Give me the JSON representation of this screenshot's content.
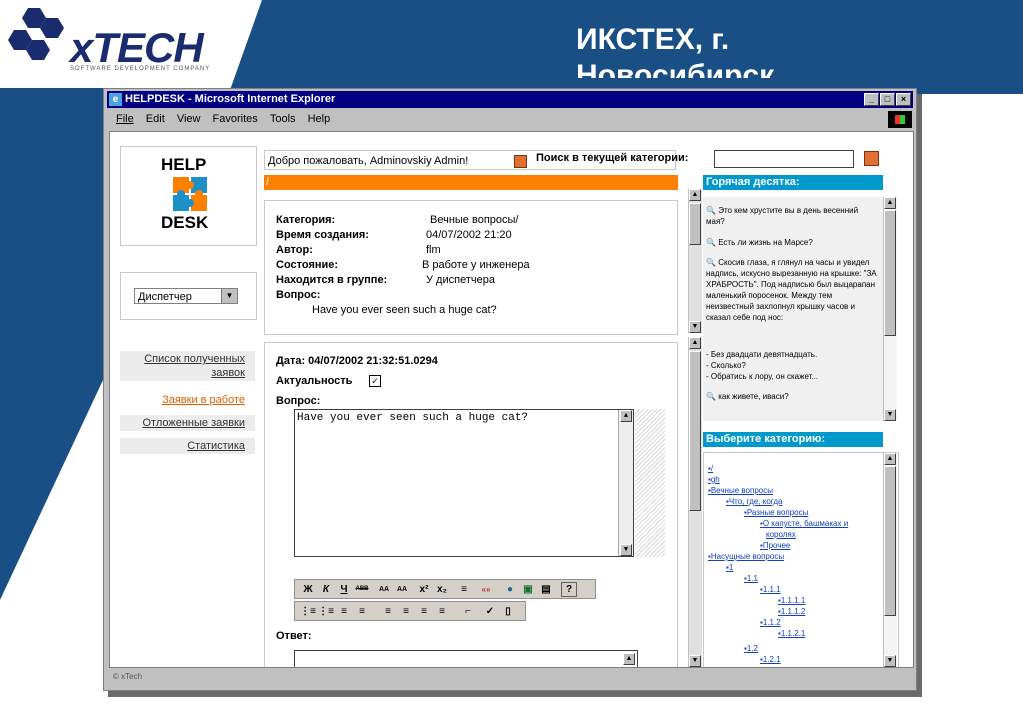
{
  "slide": {
    "logo_text": "xTECH",
    "logo_subtitle": "SOFTWARE DEVELOPMENT COMPANY",
    "title": "ИКСТЕХ, г. Новосибирск"
  },
  "window": {
    "title": "HELPDESK - Microsoft Internet Explorer",
    "menu": [
      "File",
      "Edit",
      "View",
      "Favorites",
      "Tools",
      "Help"
    ],
    "status_text": "© xTech"
  },
  "sidebar": {
    "logo_help": "HELP",
    "logo_desk": "DESK",
    "role_select_value": "Диспетчер",
    "nav": [
      {
        "label": "Список полученных заявок"
      },
      {
        "label": "Заявки в работе"
      },
      {
        "label": "Отложенные заявки"
      },
      {
        "label": "Статистика"
      }
    ]
  },
  "header": {
    "welcome": "Добро пожаловать,  Adminovskiy Admin!",
    "search_label": "Поиск в текущей категории:",
    "search_value": "",
    "path": "/"
  },
  "ticket": {
    "category_label": "Категория:",
    "category_value": "Вечные вопросы/",
    "created_label": "Время создания:",
    "created_value": "04/07/2002 21:20",
    "author_label": "Автор:",
    "author_value": "flm",
    "state_label": "Состояние:",
    "state_value": "В работе у инженера",
    "group_label": "Находится в группе:",
    "group_value": "У диспетчера",
    "question_label": "Вопрос:",
    "question_value": "Have you ever seen such a huge cat?"
  },
  "response": {
    "date_line": "Дата: 04/07/2002 21:32:51.0294",
    "relevance_label": "Актуальность",
    "relevance_checked": true,
    "question_label": "Вопрос:",
    "question_text": "Have you ever seen such a huge cat?",
    "answer_label": "Ответ:",
    "toolbar1": [
      "Ж",
      "К",
      "Ч",
      "ABB",
      "AA",
      "AA",
      "x²",
      "x₂",
      "≡",
      "«»",
      "●",
      "▣",
      "▤",
      "?"
    ],
    "toolbar2": [
      "⋮≡",
      "⋮≡",
      "≡",
      "≡",
      "≡",
      "≡",
      "≡",
      "≡",
      "⌐",
      "✓",
      "▯"
    ]
  },
  "hot_ten": {
    "heading": "Горячая десятка:",
    "items": [
      "Это кем хрустите вы в день весенний мая?",
      "Есть ли жизнь на Марсе?",
      "Скосив глаза, я глянул на часы и увидел надпись, искусно вырезанную на крышке: \"ЗА ХРАБРОСТЬ\". Под надписью был выцарапан маленький поросенок. Между тем неизвестный захлопнул крышку часов и сказал себе под нос:",
      "- Без двадцати девятнадцать.",
      "- Сколько?",
      "- Обратись к лору, он скажет...",
      "как живете, иваси?"
    ]
  },
  "categories": {
    "heading": "Выберите категорию:",
    "items": [
      {
        "label": "/"
      },
      {
        "label": "gh"
      },
      {
        "label": "Вечные вопросы"
      },
      {
        "label": "Что, где, когда"
      },
      {
        "label": "Разные вопросы"
      },
      {
        "label": "О капусте, башмаках и"
      },
      {
        "label": "королях"
      },
      {
        "label": "Прочее"
      },
      {
        "label": "Насущные вопросы"
      },
      {
        "label": "1"
      },
      {
        "label": "1.1"
      },
      {
        "label": "1.1.1"
      },
      {
        "label": "1.1.1.1"
      },
      {
        "label": "1.1.1.2"
      },
      {
        "label": "1.1.2"
      },
      {
        "label": "1.1.2.1"
      },
      {
        "label": "1.2"
      },
      {
        "label": "1.2.1"
      }
    ]
  },
  "colors": {
    "slide_blue": "#1a4f86",
    "orange": "#ff7f00",
    "cyan": "#0099cc",
    "ie_title": "#000080"
  }
}
